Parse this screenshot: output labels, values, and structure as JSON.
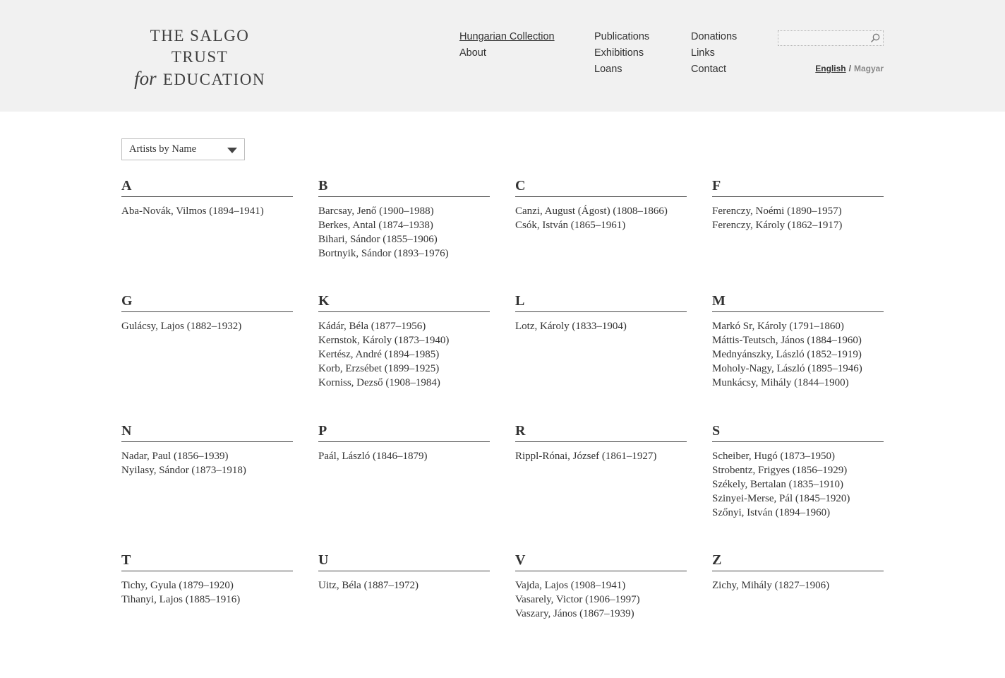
{
  "logo": {
    "line1": "THE SALGO",
    "line2": "TRUST",
    "for": "for",
    "line3": "EDUCATION"
  },
  "nav": {
    "col1": [
      "Hungarian Collection",
      "About"
    ],
    "col2": [
      "Publications",
      "Exhibitions",
      "Loans"
    ],
    "col3": [
      "Donations",
      "Links",
      "Contact"
    ]
  },
  "search": {
    "placeholder": "",
    "icon": "search-icon"
  },
  "language": {
    "english": "English",
    "separator": "/",
    "magyar": "Magyar"
  },
  "filter": {
    "selected": "Artists by Name"
  },
  "sections": [
    {
      "letter": "A",
      "artists": [
        "Aba-Novák, Vilmos (1894–1941)"
      ]
    },
    {
      "letter": "B",
      "artists": [
        "Barcsay, Jenő (1900–1988)",
        "Berkes, Antal (1874–1938)",
        "Bihari, Sándor (1855–1906)",
        "Bortnyik, Sándor (1893–1976)"
      ]
    },
    {
      "letter": "C",
      "artists": [
        "Canzi, August (Ágost) (1808–1866)",
        "Csók, István (1865–1961)"
      ]
    },
    {
      "letter": "F",
      "artists": [
        "Ferenczy, Noémi (1890–1957)",
        "Ferenczy, Károly (1862–1917)"
      ]
    },
    {
      "letter": "G",
      "artists": [
        "Gulácsy, Lajos (1882–1932)"
      ]
    },
    {
      "letter": "K",
      "artists": [
        "Kádár, Béla (1877–1956)",
        "Kernstok, Károly (1873–1940)",
        "Kertész, André (1894–1985)",
        "Korb, Erzsébet (1899–1925)",
        "Korniss, Dezső (1908–1984)"
      ]
    },
    {
      "letter": "L",
      "artists": [
        "Lotz, Károly (1833–1904)"
      ]
    },
    {
      "letter": "M",
      "artists": [
        "Markó Sr, Károly (1791–1860)",
        "Máttis-Teutsch, János (1884–1960)",
        "Mednyánszky, László (1852–1919)",
        "Moholy-Nagy, László (1895–1946)",
        "Munkácsy, Mihály (1844–1900)"
      ]
    },
    {
      "letter": "N",
      "artists": [
        "Nadar, Paul (1856–1939)",
        "Nyilasy, Sándor (1873–1918)"
      ]
    },
    {
      "letter": "P",
      "artists": [
        "Paál, László (1846–1879)"
      ]
    },
    {
      "letter": "R",
      "artists": [
        "Rippl-Rónai, József (1861–1927)"
      ]
    },
    {
      "letter": "S",
      "artists": [
        "Scheiber, Hugó (1873–1950)",
        "Strobentz, Frigyes (1856–1929)",
        "Székely, Bertalan (1835–1910)",
        "Szinyei-Merse, Pál (1845–1920)",
        "Szőnyi, István (1894–1960)"
      ]
    },
    {
      "letter": "T",
      "artists": [
        "Tichy, Gyula (1879–1920)",
        "Tihanyi, Lajos (1885–1916)"
      ]
    },
    {
      "letter": "U",
      "artists": [
        "Uitz, Béla (1887–1972)"
      ]
    },
    {
      "letter": "V",
      "artists": [
        "Vajda, Lajos (1908–1941)",
        "Vasarely, Victor (1906–1997)",
        "Vaszary, János (1867–1939)"
      ]
    },
    {
      "letter": "Z",
      "artists": [
        "Zichy, Mihály (1827–1906)"
      ]
    }
  ]
}
